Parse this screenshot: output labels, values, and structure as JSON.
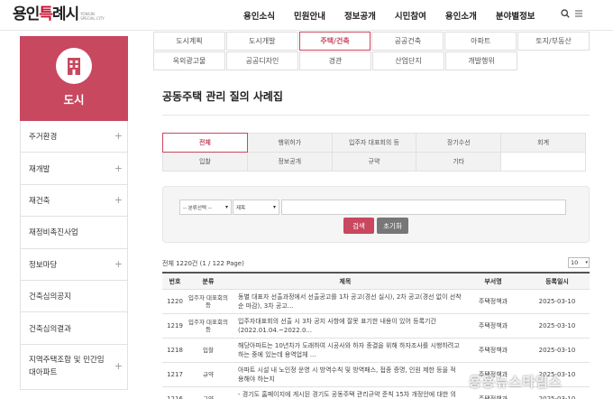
{
  "header": {
    "logo_main": "용인",
    "logo_accent": "특",
    "logo_rest": "례시",
    "logo_sub": "YONGIN SPECIAL CITY",
    "nav": [
      "용인소식",
      "민원안내",
      "정보공개",
      "시민참여",
      "용인소개",
      "분야별정보"
    ],
    "icons": [
      "search-icon",
      "menu-icon"
    ]
  },
  "sidebar": {
    "title": "도시",
    "icon": "building-icon",
    "items": [
      {
        "label": "주거환경",
        "expandable": true
      },
      {
        "label": "재개발",
        "expandable": true
      },
      {
        "label": "재건축",
        "expandable": true
      },
      {
        "label": "재정비촉진사업",
        "expandable": false
      },
      {
        "label": "정보마당",
        "expandable": true
      },
      {
        "label": "건축심의공지",
        "expandable": false
      },
      {
        "label": "건축심의결과",
        "expandable": false
      },
      {
        "label": "지역주택조합 및 민간임대아파트",
        "expandable": true
      }
    ]
  },
  "subtabs": {
    "row1": [
      "도시계획",
      "도시개발",
      "주택/건축",
      "공공건축",
      "아파트",
      "토지/부동산"
    ],
    "row2": [
      "옥외광고물",
      "공공디자인",
      "경관",
      "산업단지",
      "개발행위"
    ],
    "active": "주택/건축"
  },
  "page_title": "공동주택 관리 질의 사례집",
  "categories": {
    "row1": [
      "전체",
      "행위허가",
      "입주자 대표회의 등",
      "장기수선",
      "회계"
    ],
    "row2": [
      "입찰",
      "정보공개",
      "규약",
      "기타"
    ],
    "active": "전체"
  },
  "search": {
    "category_select": "-- 분류선택 --",
    "field_select": "제목",
    "keyword_value": "",
    "search_label": "검색",
    "reset_label": "초기화"
  },
  "list": {
    "total_text": "전체 1220건 (1 / 122 Page)",
    "per_page": "10",
    "columns": [
      "번호",
      "분류",
      "제목",
      "부서명",
      "등록일시"
    ],
    "rows": [
      {
        "no": "1220",
        "cat": "입주자 대표회의 등",
        "title": "동별 대표자 선출과정에서 선출공고를 1차 공고(경선 실시), 2차 공고(경선 없이 선착순 마감), 3차 공고...",
        "dept": "주택정책과",
        "date": "2025-03-10"
      },
      {
        "no": "1219",
        "cat": "입주자 대표회의 등",
        "title": "입주자대표회의 선출 시 3차 공지 사항에 잘못 표기한 내용이 있어 등록기간(2022.01.04.~2022.0...",
        "dept": "주택정책과",
        "date": "2025-03-10"
      },
      {
        "no": "1218",
        "cat": "입찰",
        "title": "해당아파트는 10년차가 도래하여 시공사와 하자 종결을 위해 하자조사를 시행하려고 하는 중에 있는데 용역업체 ...",
        "dept": "주택정책과",
        "date": "2025-03-10"
      },
      {
        "no": "1217",
        "cat": "규약",
        "title": "아파트 시설 내 노인정 운영 시 방역수칙 및 방역패스, 접종 증명, 인원 제한 등을 적용해야 하는지",
        "dept": "주택정책과",
        "date": "2025-03-10"
      },
      {
        "no": "1216",
        "cat": "규약",
        "title": "- 경기도 홈페이지에 게시된 경기도 공동주택 관리규약 준칙 15차 개정안에 대한 의견조회를 진행 중...",
        "dept": "주택정책과",
        "date": "2025-03-10"
      }
    ]
  },
  "watermark": "용용뉴스타임스",
  "colors": {
    "accent": "#c8485f",
    "brand_red": "#c8102e"
  }
}
